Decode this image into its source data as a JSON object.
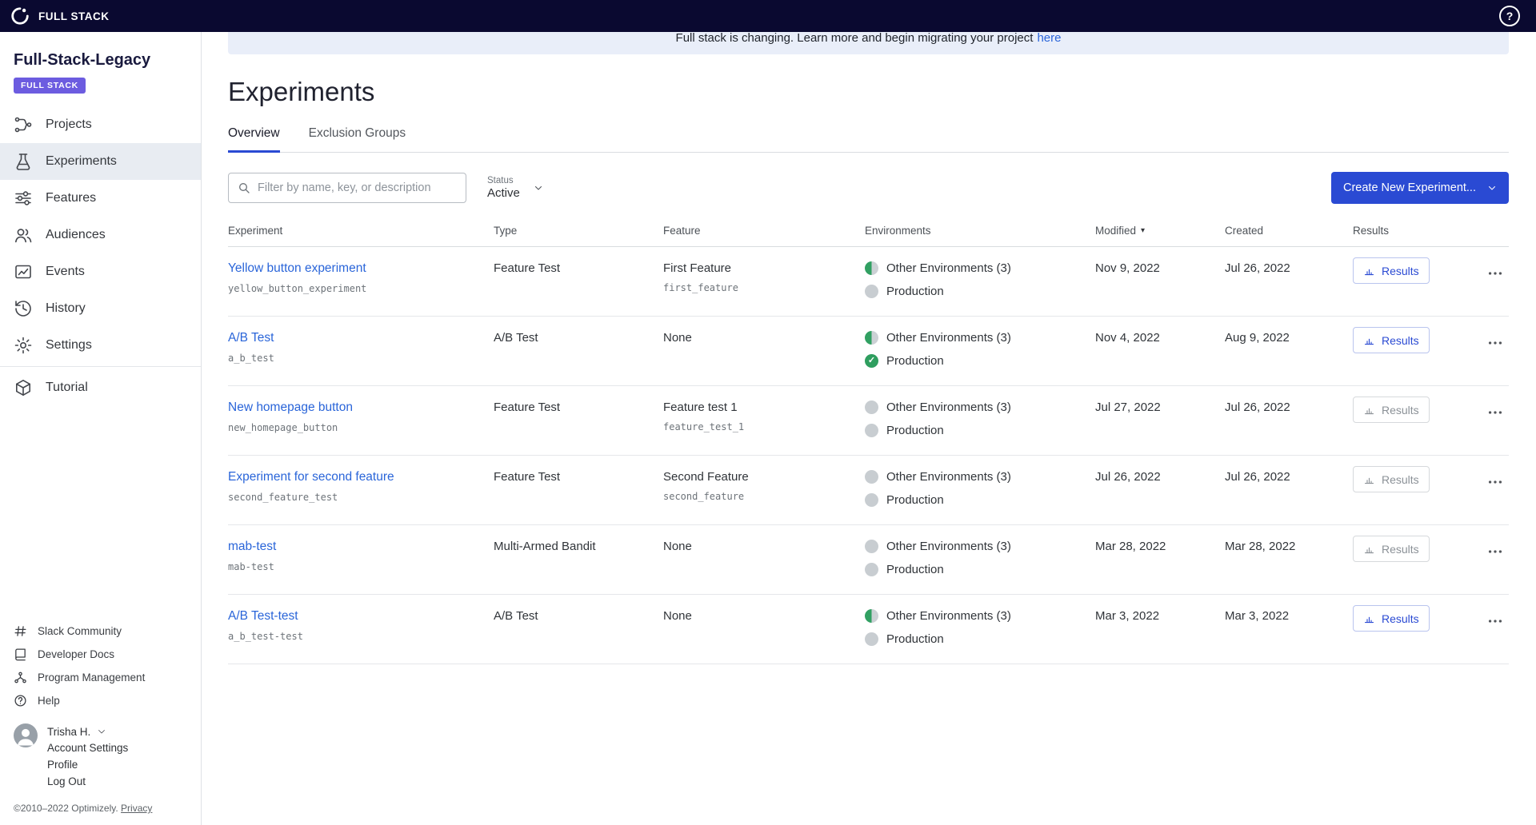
{
  "topbar": {
    "brand": "FULL STACK"
  },
  "sidebar": {
    "project_name": "Full-Stack-Legacy",
    "badge": "FULL STACK",
    "nav": [
      {
        "label": "Projects"
      },
      {
        "label": "Experiments",
        "active": true
      },
      {
        "label": "Features"
      },
      {
        "label": "Audiences"
      },
      {
        "label": "Events"
      },
      {
        "label": "History"
      },
      {
        "label": "Settings"
      },
      {
        "label": "Tutorial"
      }
    ],
    "links": [
      {
        "label": "Slack Community"
      },
      {
        "label": "Developer Docs"
      },
      {
        "label": "Program Management"
      },
      {
        "label": "Help"
      }
    ],
    "user": {
      "name": "Trisha H.",
      "menu": [
        {
          "label": "Account Settings"
        },
        {
          "label": "Profile"
        },
        {
          "label": "Log Out"
        }
      ]
    },
    "copyright": "©2010–2022 Optimizely.",
    "privacy_label": "Privacy"
  },
  "banner": {
    "text": "Full stack is changing. Learn more and begin migrating your project",
    "link_label": "here"
  },
  "page": {
    "title": "Experiments"
  },
  "tabs": [
    {
      "label": "Overview",
      "active": true
    },
    {
      "label": "Exclusion Groups"
    }
  ],
  "toolbar": {
    "filter_placeholder": "Filter by name, key, or description",
    "status_label": "Status",
    "status_value": "Active",
    "create_label": "Create New Experiment..."
  },
  "table": {
    "headers": {
      "experiment": "Experiment",
      "type": "Type",
      "feature": "Feature",
      "environments": "Environments",
      "modified": "Modified",
      "created": "Created",
      "results": "Results"
    },
    "results_label": "Results",
    "rows": [
      {
        "name": "Yellow button experiment",
        "key": "yellow_button_experiment",
        "type": "Feature Test",
        "feature": "First Feature",
        "feature_key": "first_feature",
        "environments": [
          {
            "label": "Other Environments (3)",
            "status": "half"
          },
          {
            "label": "Production",
            "status": "off"
          }
        ],
        "modified": "Nov 9, 2022",
        "created": "Jul 26, 2022",
        "results_state": "enabled"
      },
      {
        "name": "A/B Test",
        "key": "a_b_test",
        "type": "A/B Test",
        "feature": "None",
        "feature_key": "",
        "environments": [
          {
            "label": "Other Environments (3)",
            "status": "half"
          },
          {
            "label": "Production",
            "status": "on"
          }
        ],
        "modified": "Nov 4, 2022",
        "created": "Aug 9, 2022",
        "results_state": "enabled"
      },
      {
        "name": "New homepage button",
        "key": "new_homepage_button",
        "type": "Feature Test",
        "feature": "Feature test 1",
        "feature_key": "feature_test_1",
        "environments": [
          {
            "label": "Other Environments (3)",
            "status": "off"
          },
          {
            "label": "Production",
            "status": "off"
          }
        ],
        "modified": "Jul 27, 2022",
        "created": "Jul 26, 2022",
        "results_state": "disabled"
      },
      {
        "name": "Experiment for second feature",
        "key": "second_feature_test",
        "type": "Feature Test",
        "feature": "Second Feature",
        "feature_key": "second_feature",
        "environments": [
          {
            "label": "Other Environments (3)",
            "status": "off"
          },
          {
            "label": "Production",
            "status": "off"
          }
        ],
        "modified": "Jul 26, 2022",
        "created": "Jul 26, 2022",
        "results_state": "disabled"
      },
      {
        "name": "mab-test",
        "key": "mab-test",
        "type": "Multi-Armed Bandit",
        "feature": "None",
        "feature_key": "",
        "environments": [
          {
            "label": "Other Environments (3)",
            "status": "off"
          },
          {
            "label": "Production",
            "status": "off"
          }
        ],
        "modified": "Mar 28, 2022",
        "created": "Mar 28, 2022",
        "results_state": "disabled"
      },
      {
        "name": "A/B Test-test",
        "key": "a_b_test-test",
        "type": "A/B Test",
        "feature": "None",
        "feature_key": "",
        "environments": [
          {
            "label": "Other Environments (3)",
            "status": "half"
          },
          {
            "label": "Production",
            "status": "off"
          }
        ],
        "modified": "Mar 3, 2022",
        "created": "Mar 3, 2022",
        "results_state": "enabled"
      }
    ]
  },
  "colors": {
    "topbar_navy": "#0a0930",
    "accent_blue": "#2a4ad3",
    "link_blue": "#2a65d9",
    "badge_purple": "#6c5ce0",
    "success_green": "#2f9e5f",
    "banner_bg": "#e9eef9"
  }
}
